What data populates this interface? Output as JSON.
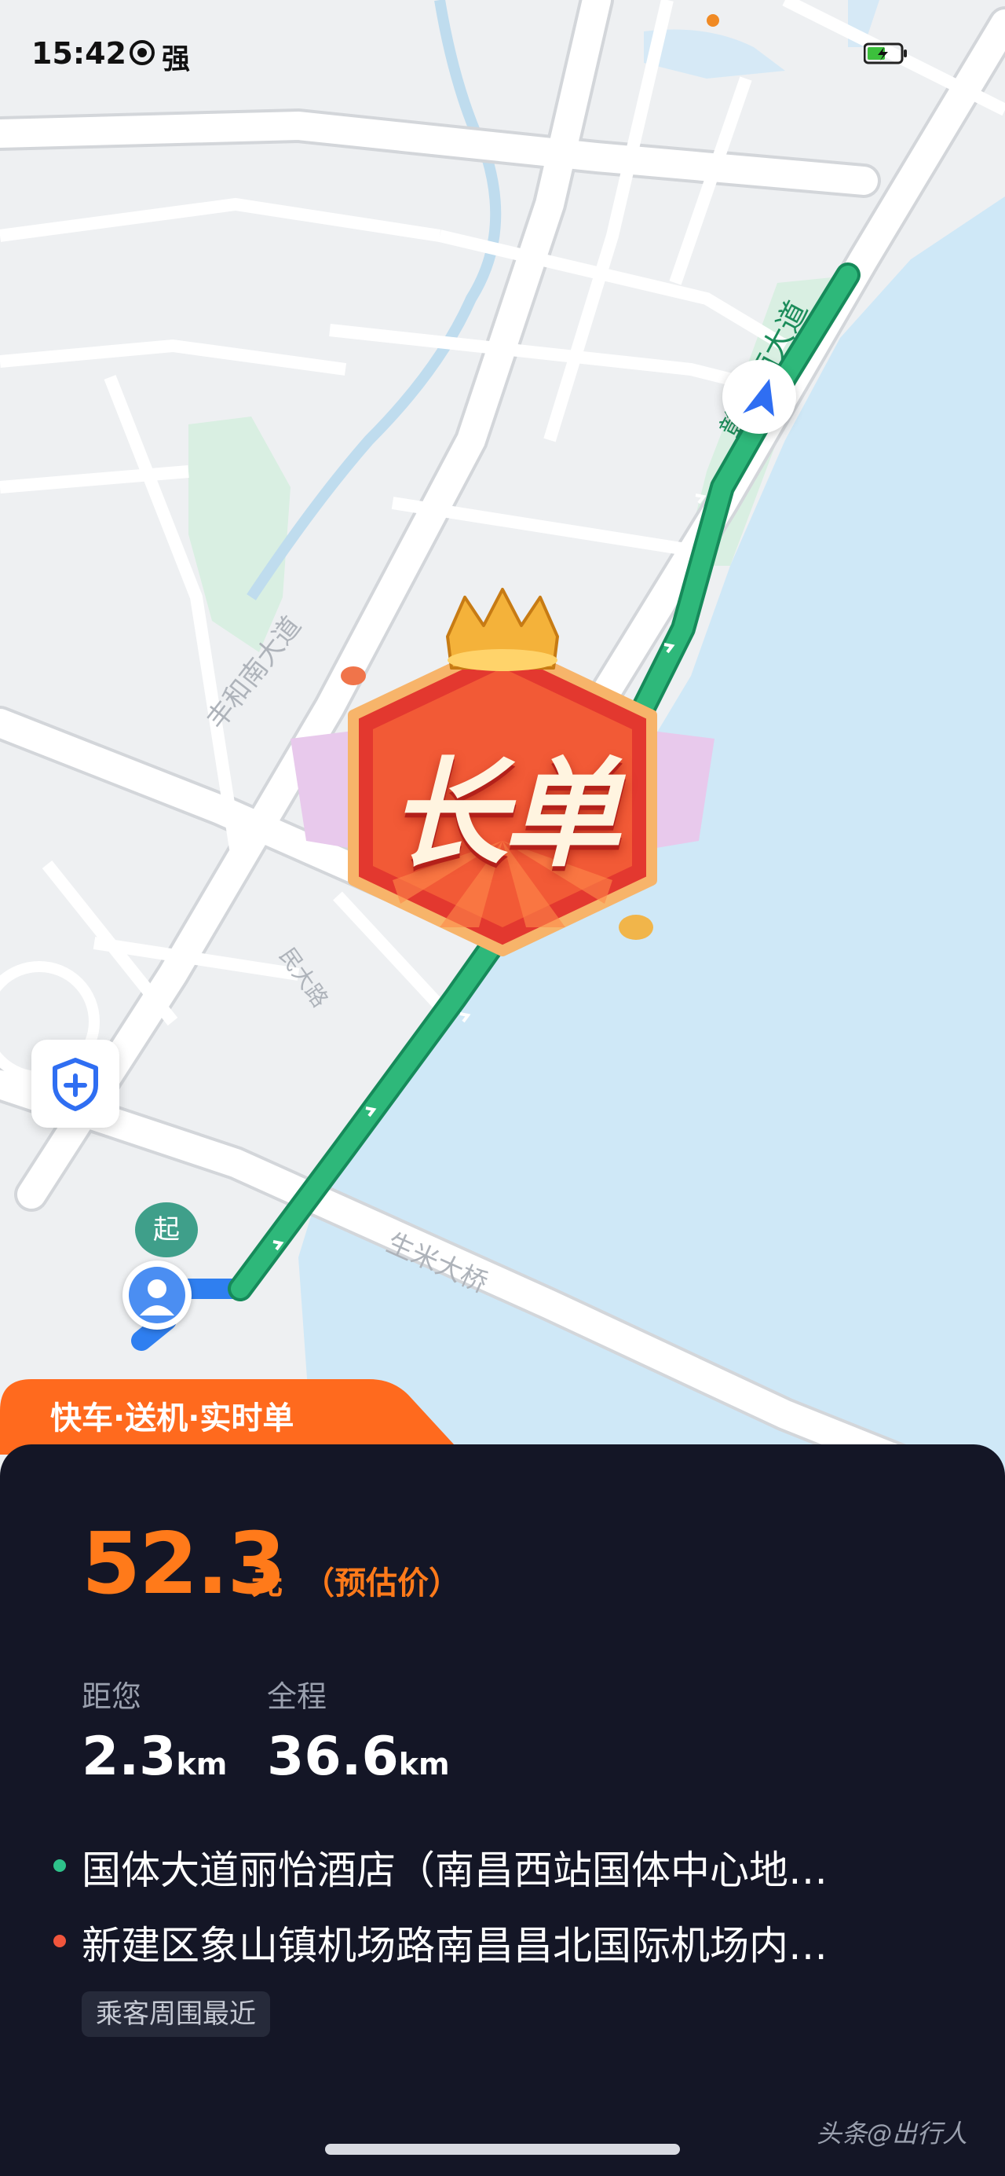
{
  "status_bar": {
    "time": "15:42",
    "network": "强",
    "signal_icon": "signal-icon",
    "battery_icon": "battery-charging-icon"
  },
  "map": {
    "road_labels": [
      "丰和南大道",
      "生米大桥",
      "赣江南大道",
      "丰和南大道"
    ],
    "start_marker": "起",
    "long_order_badge": "长单",
    "colors": {
      "route": "#2eb87a",
      "water": "#cfe8f7",
      "land": "#eef0f2",
      "park": "#d9efe2"
    }
  },
  "order": {
    "tag": "快车·送机·实时单",
    "price": "52.3",
    "price_unit": "元",
    "price_note": "（预估价）",
    "distance_label": "距您",
    "distance_value": "2.3",
    "distance_unit": "km",
    "total_label": "全程",
    "total_value": "36.6",
    "total_unit": "km",
    "pickup": "国体大道丽怡酒店（南昌西站国体中心地…",
    "dropoff": "新建区象山镇机场路南昌昌北国际机场内…",
    "chip": "乘客周围最近",
    "colors": {
      "accent": "#ff7a1a",
      "pickup_dot": "#2ec28a",
      "dropoff_dot": "#f0553c"
    }
  },
  "watermark": "头条@出行人"
}
